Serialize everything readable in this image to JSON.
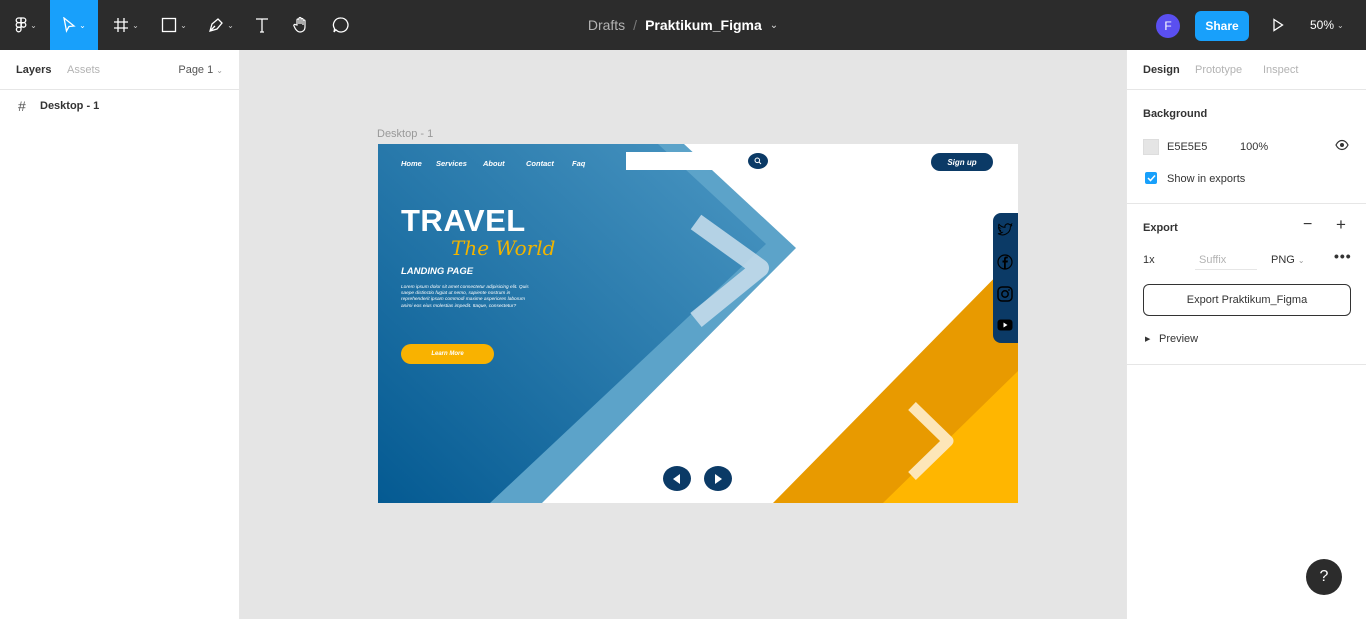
{
  "toolbar": {
    "breadcrumb_folder": "Drafts",
    "breadcrumb_separator": "/",
    "file_name": "Praktikum_Figma",
    "user_initial": "F",
    "share_label": "Share",
    "zoom_level": "50%"
  },
  "left_panel": {
    "tab_layers": "Layers",
    "tab_assets": "Assets",
    "page_selector": "Page 1",
    "layers": [
      {
        "name": "Desktop - 1"
      }
    ]
  },
  "canvas": {
    "frame_label": "Desktop - 1",
    "design": {
      "nav": [
        "Home",
        "Services",
        "About",
        "Contact",
        "Faq"
      ],
      "signup": "Sign up",
      "title": "TRAVEL",
      "subtitle": "The World",
      "tagline": "LANDING PAGE",
      "lorem": "Lorem ipsum dolor sit amet consectetur adipisicing elit. Quis saepe distinctio fugiat ut nemo, sapiente nostrum in reprehenderit ipsam commodi maxime asperiores laborum animi eos eius molestias impedit. Itaque, consectetur?",
      "cta": "Learn More",
      "colors": {
        "blue_dark": "#0b3a66",
        "blue_mid": "#2f7fb0",
        "blue_light": "#5ca3c9",
        "orange": "#e89a00",
        "yellow": "#f9b200"
      }
    }
  },
  "right_panel": {
    "tab_design": "Design",
    "tab_prototype": "Prototype",
    "tab_inspect": "Inspect",
    "background_heading": "Background",
    "background_hex": "E5E5E5",
    "background_opacity": "100%",
    "show_in_exports": "Show in exports",
    "export_heading": "Export",
    "export_scale": "1x",
    "export_suffix_placeholder": "Suffix",
    "export_format": "PNG",
    "export_button": "Export Praktikum_Figma",
    "preview_label": "Preview"
  },
  "help_label": "?"
}
